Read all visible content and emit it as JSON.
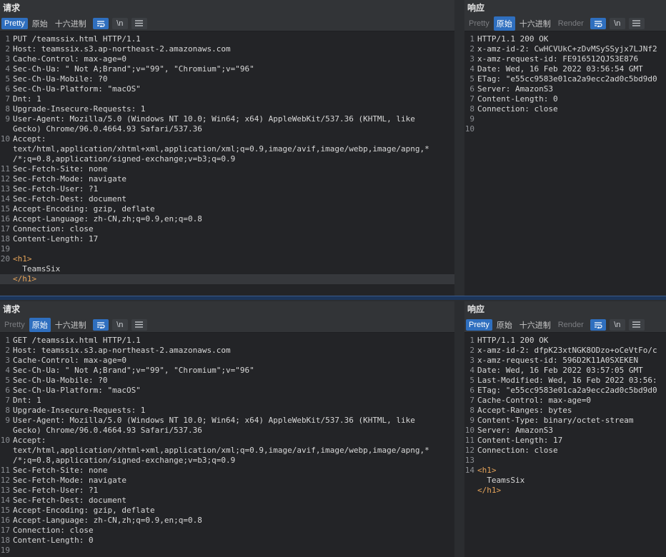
{
  "top": {
    "request": {
      "title": "请求",
      "tabs": [
        "Pretty",
        "原始",
        "十六进制"
      ],
      "active_tab": 0,
      "newline_label": "\\n",
      "lines": [
        {
          "n": "1",
          "t": "PUT /teamssix.html HTTP/1.1"
        },
        {
          "n": "2",
          "t": "Host: teamssix.s3.ap-northeast-2.amazonaws.com"
        },
        {
          "n": "3",
          "t": "Cache-Control: max-age=0"
        },
        {
          "n": "4",
          "t": "Sec-Ch-Ua: \" Not A;Brand\";v=\"99\", \"Chromium\";v=\"96\""
        },
        {
          "n": "5",
          "t": "Sec-Ch-Ua-Mobile: ?0"
        },
        {
          "n": "6",
          "t": "Sec-Ch-Ua-Platform: \"macOS\""
        },
        {
          "n": "7",
          "t": "Dnt: 1"
        },
        {
          "n": "8",
          "t": "Upgrade-Insecure-Requests: 1"
        },
        {
          "n": "9",
          "t": "User-Agent: Mozilla/5.0 (Windows NT 10.0; Win64; x64) AppleWebKit/537.36 (KHTML, like"
        },
        {
          "n": "",
          "t": "Gecko) Chrome/96.0.4664.93 Safari/537.36"
        },
        {
          "n": "10",
          "t": "Accept:"
        },
        {
          "n": "",
          "t": "text/html,application/xhtml+xml,application/xml;q=0.9,image/avif,image/webp,image/apng,*"
        },
        {
          "n": "",
          "t": "/*;q=0.8,application/signed-exchange;v=b3;q=0.9"
        },
        {
          "n": "11",
          "t": "Sec-Fetch-Site: none"
        },
        {
          "n": "12",
          "t": "Sec-Fetch-Mode: navigate"
        },
        {
          "n": "13",
          "t": "Sec-Fetch-User: ?1"
        },
        {
          "n": "14",
          "t": "Sec-Fetch-Dest: document"
        },
        {
          "n": "15",
          "t": "Accept-Encoding: gzip, deflate"
        },
        {
          "n": "16",
          "t": "Accept-Language: zh-CN,zh;q=0.9,en;q=0.8"
        },
        {
          "n": "17",
          "t": "Connection: close"
        },
        {
          "n": "18",
          "t": "Content-Length: 17"
        },
        {
          "n": "19",
          "t": ""
        },
        {
          "n": "20",
          "t": "<h1>",
          "tag": true
        },
        {
          "n": "",
          "t": "  TeamsSix"
        },
        {
          "n": "",
          "t": "</h1>",
          "tag": true,
          "hl": true
        }
      ]
    },
    "response": {
      "title": "响应",
      "tabs": [
        "Pretty",
        "原始",
        "十六进制",
        "Render"
      ],
      "active_tab": 1,
      "newline_label": "\\n",
      "lines": [
        {
          "n": "1",
          "t": "HTTP/1.1 200 OK"
        },
        {
          "n": "2",
          "t": "x-amz-id-2: CwHCVUkC+zDvMSySSyjx7LJNf2"
        },
        {
          "n": "3",
          "t": "x-amz-request-id: FE916512QJS3E876"
        },
        {
          "n": "4",
          "t": "Date: Wed, 16 Feb 2022 03:56:54 GMT"
        },
        {
          "n": "5",
          "t": "ETag: \"e55cc9583e01ca2a9ecc2ad0c5bd9d0"
        },
        {
          "n": "6",
          "t": "Server: AmazonS3"
        },
        {
          "n": "7",
          "t": "Content-Length: 0"
        },
        {
          "n": "8",
          "t": "Connection: close"
        },
        {
          "n": "9",
          "t": ""
        },
        {
          "n": "10",
          "t": ""
        }
      ]
    }
  },
  "bottom": {
    "request": {
      "title": "请求",
      "tabs": [
        "Pretty",
        "原始",
        "十六进制"
      ],
      "active_tab": 1,
      "newline_label": "\\n",
      "lines": [
        {
          "n": "1",
          "t": "GET /teamssix.html HTTP/1.1"
        },
        {
          "n": "2",
          "t": "Host: teamssix.s3.ap-northeast-2.amazonaws.com"
        },
        {
          "n": "3",
          "t": "Cache-Control: max-age=0"
        },
        {
          "n": "4",
          "t": "Sec-Ch-Ua: \" Not A;Brand\";v=\"99\", \"Chromium\";v=\"96\""
        },
        {
          "n": "5",
          "t": "Sec-Ch-Ua-Mobile: ?0"
        },
        {
          "n": "6",
          "t": "Sec-Ch-Ua-Platform: \"macOS\""
        },
        {
          "n": "7",
          "t": "Dnt: 1"
        },
        {
          "n": "8",
          "t": "Upgrade-Insecure-Requests: 1"
        },
        {
          "n": "9",
          "t": "User-Agent: Mozilla/5.0 (Windows NT 10.0; Win64; x64) AppleWebKit/537.36 (KHTML, like"
        },
        {
          "n": "",
          "t": "Gecko) Chrome/96.0.4664.93 Safari/537.36"
        },
        {
          "n": "10",
          "t": "Accept:"
        },
        {
          "n": "",
          "t": "text/html,application/xhtml+xml,application/xml;q=0.9,image/avif,image/webp,image/apng,*"
        },
        {
          "n": "",
          "t": "/*;q=0.8,application/signed-exchange;v=b3;q=0.9"
        },
        {
          "n": "11",
          "t": "Sec-Fetch-Site: none"
        },
        {
          "n": "12",
          "t": "Sec-Fetch-Mode: navigate"
        },
        {
          "n": "13",
          "t": "Sec-Fetch-User: ?1"
        },
        {
          "n": "14",
          "t": "Sec-Fetch-Dest: document"
        },
        {
          "n": "15",
          "t": "Accept-Encoding: gzip, deflate"
        },
        {
          "n": "16",
          "t": "Accept-Language: zh-CN,zh;q=0.9,en;q=0.8"
        },
        {
          "n": "17",
          "t": "Connection: close"
        },
        {
          "n": "18",
          "t": "Content-Length: 0"
        },
        {
          "n": "19",
          "t": ""
        }
      ]
    },
    "response": {
      "title": "响应",
      "tabs": [
        "Pretty",
        "原始",
        "十六进制",
        "Render"
      ],
      "active_tab": 0,
      "newline_label": "\\n",
      "lines": [
        {
          "n": "1",
          "t": "HTTP/1.1 200 OK"
        },
        {
          "n": "2",
          "t": "x-amz-id-2: dfpK23xtNGK8ODzo+oCeVtFo/c"
        },
        {
          "n": "3",
          "t": "x-amz-request-id: 596D2K11A0SXEKEN"
        },
        {
          "n": "4",
          "t": "Date: Wed, 16 Feb 2022 03:57:05 GMT"
        },
        {
          "n": "5",
          "t": "Last-Modified: Wed, 16 Feb 2022 03:56:"
        },
        {
          "n": "6",
          "t": "ETag: \"e55cc9583e01ca2a9ecc2ad0c5bd9d0"
        },
        {
          "n": "7",
          "t": "Cache-Control: max-age=0"
        },
        {
          "n": "8",
          "t": "Accept-Ranges: bytes"
        },
        {
          "n": "9",
          "t": "Content-Type: binary/octet-stream"
        },
        {
          "n": "10",
          "t": "Server: AmazonS3"
        },
        {
          "n": "11",
          "t": "Content-Length: 17"
        },
        {
          "n": "12",
          "t": "Connection: close"
        },
        {
          "n": "13",
          "t": ""
        },
        {
          "n": "14",
          "t": "<h1>",
          "tag": true
        },
        {
          "n": "",
          "t": "  TeamsSix"
        },
        {
          "n": "",
          "t": "</h1>",
          "tag": true
        }
      ]
    }
  },
  "colors": {
    "accent": "#2f6fbf",
    "tag": "#e6a45a"
  },
  "icons": {
    "wrap": "wrap-icon",
    "menu": "menu-icon"
  }
}
